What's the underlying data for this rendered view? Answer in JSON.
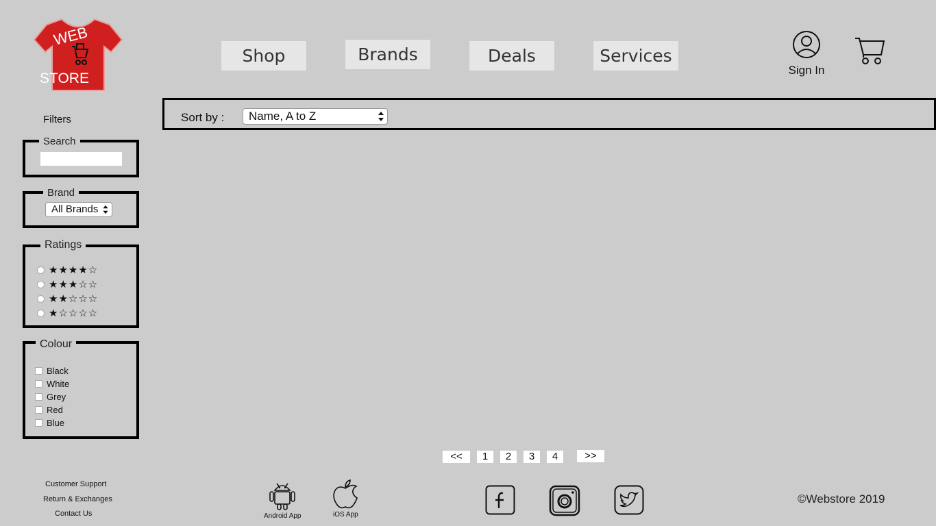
{
  "logo": {
    "line1": "WEB",
    "line2": "STORE"
  },
  "nav": {
    "tabs": [
      {
        "label": "Shop"
      },
      {
        "label": "Brands"
      },
      {
        "label": "Deals"
      },
      {
        "label": "Services"
      }
    ]
  },
  "account": {
    "signin_label": "Sign In",
    "user_icon": "user-circle-icon",
    "cart_icon": "shopping-cart-icon"
  },
  "sort": {
    "label": "Sort by :",
    "selected": "Name, A to Z"
  },
  "filters": {
    "title": "Filters",
    "search": {
      "legend": "Search",
      "value": ""
    },
    "brand": {
      "legend": "Brand",
      "selected": "All Brands"
    },
    "ratings": {
      "legend": "Ratings",
      "options": [
        {
          "stars": "★★★★☆",
          "value": 4
        },
        {
          "stars": "★★★☆☆",
          "value": 3
        },
        {
          "stars": "★★☆☆☆",
          "value": 2
        },
        {
          "stars": "★☆☆☆☆",
          "value": 1
        }
      ]
    },
    "colour": {
      "legend": "Colour",
      "options": [
        "Black",
        "White",
        "Grey",
        "Red",
        "Blue"
      ]
    }
  },
  "pagination": {
    "prev": "<<",
    "pages": [
      "1",
      "2",
      "3",
      "4"
    ],
    "next": ">>"
  },
  "footer": {
    "links": [
      "Customer Support",
      "Return & Exchanges",
      "Contact Us"
    ],
    "apps": [
      {
        "label": "Android App",
        "icon": "android-icon"
      },
      {
        "label": "iOS App",
        "icon": "apple-icon"
      }
    ],
    "social": [
      "facebook-icon",
      "instagram-icon",
      "twitter-icon"
    ],
    "copyright": "©Webstore 2019"
  },
  "colors": {
    "background": "#cccccc",
    "logo_red": "#d01f1f",
    "tab_bg": "#e6e6e6"
  }
}
